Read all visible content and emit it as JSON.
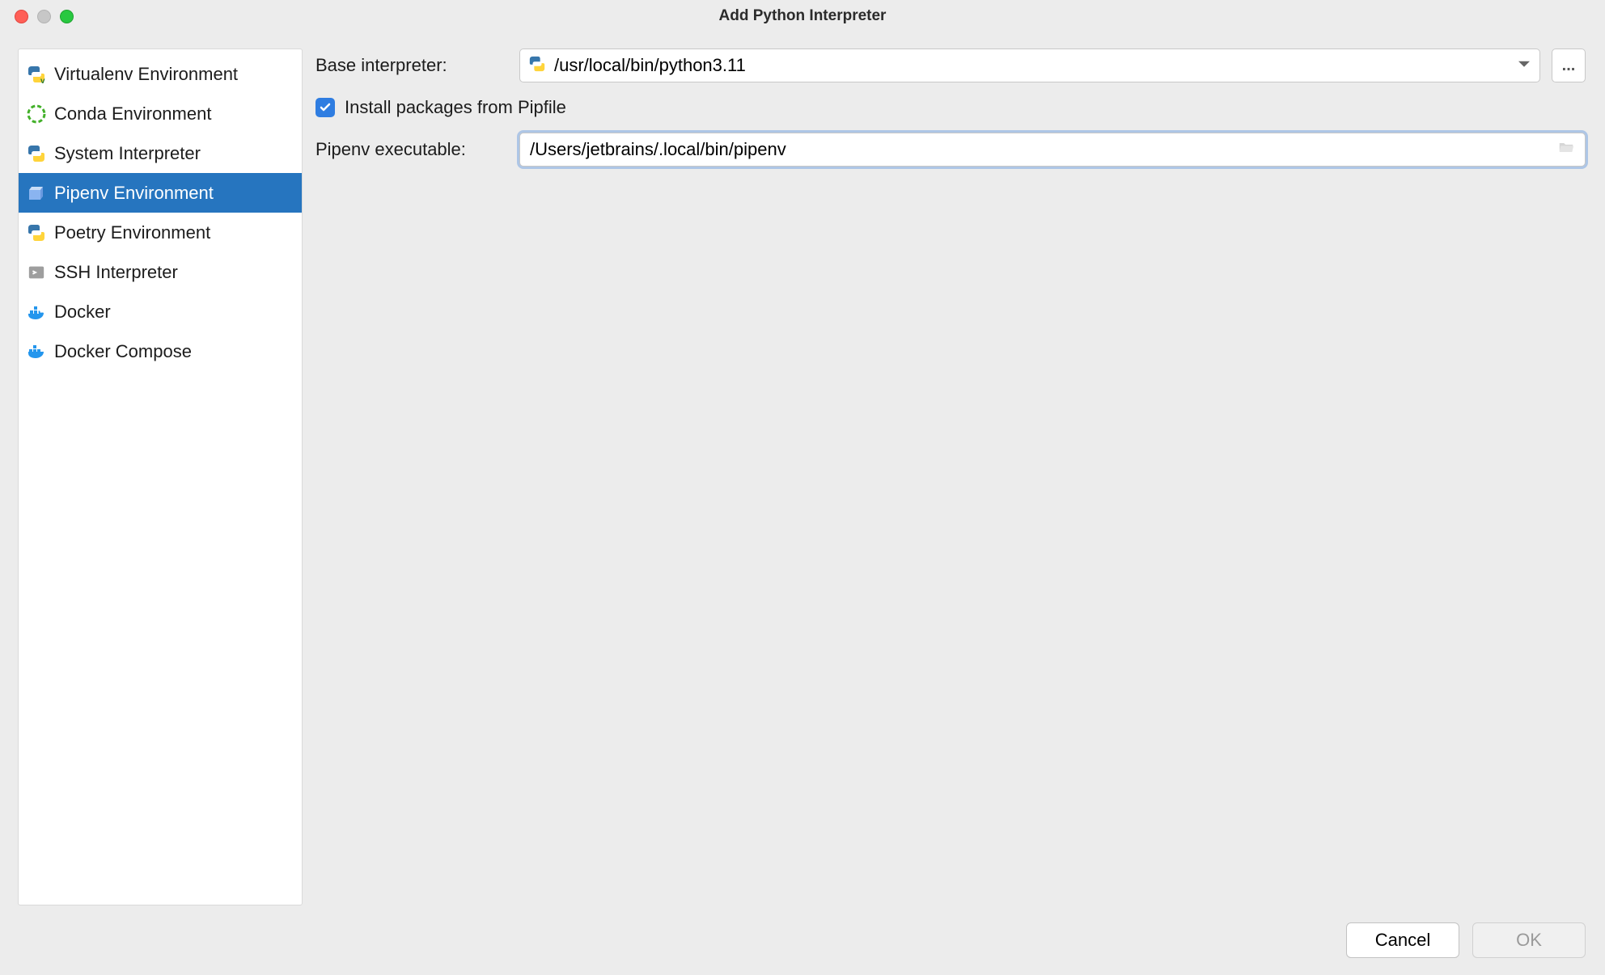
{
  "window": {
    "title": "Add Python Interpreter"
  },
  "sidebar": {
    "items": [
      {
        "label": "Virtualenv Environment",
        "icon": "python-v-icon"
      },
      {
        "label": "Conda Environment",
        "icon": "conda-icon"
      },
      {
        "label": "System Interpreter",
        "icon": "python-icon"
      },
      {
        "label": "Pipenv Environment",
        "icon": "pipenv-icon",
        "selected": true
      },
      {
        "label": "Poetry Environment",
        "icon": "python-icon"
      },
      {
        "label": "SSH Interpreter",
        "icon": "ssh-icon"
      },
      {
        "label": "Docker",
        "icon": "docker-icon"
      },
      {
        "label": "Docker Compose",
        "icon": "docker-compose-icon"
      }
    ]
  },
  "form": {
    "base_interpreter_label": "Base interpreter:",
    "base_interpreter_value": "/usr/local/bin/python3.11",
    "browse_ellipsis": "...",
    "install_pipfile_label": "Install packages from Pipfile",
    "install_pipfile_checked": true,
    "pipenv_exec_label": "Pipenv executable:",
    "pipenv_exec_value": "/Users/jetbrains/.local/bin/pipenv"
  },
  "buttons": {
    "cancel": "Cancel",
    "ok": "OK"
  }
}
